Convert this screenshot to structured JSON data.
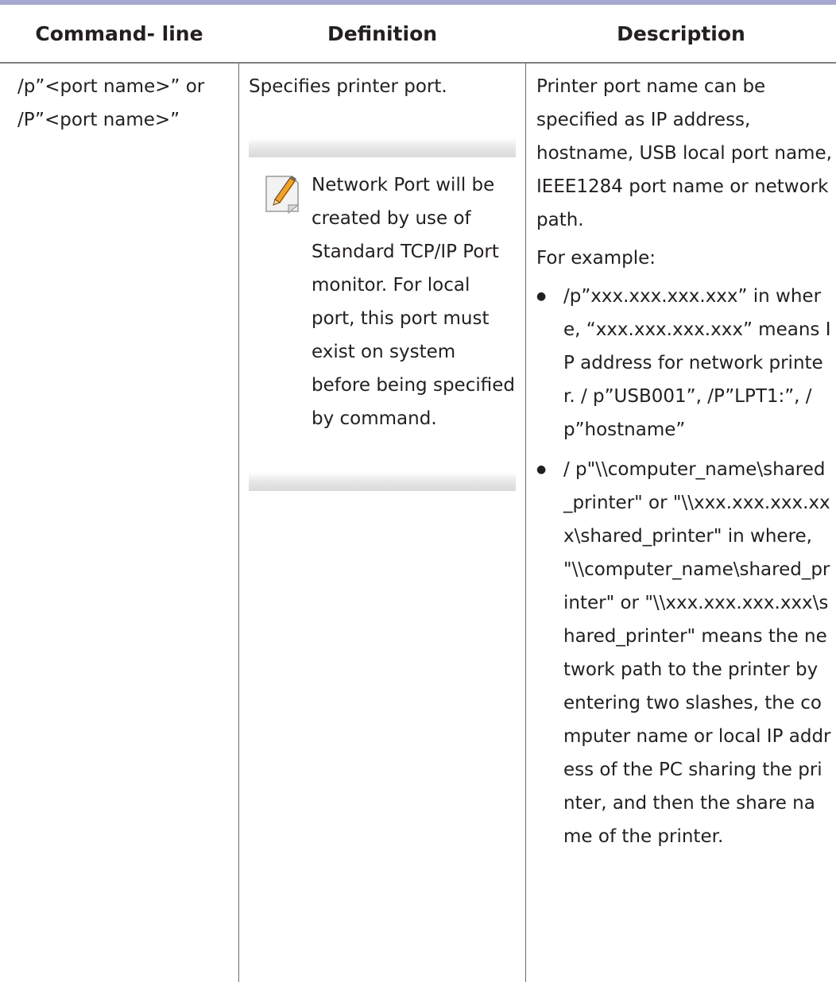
{
  "table": {
    "headers": [
      "Command- line",
      "Definition",
      "Description"
    ],
    "row": {
      "command": {
        "line1": "/p”<port name>” or",
        "line2": "/P”<port name>”"
      },
      "definition": {
        "text": "Specifies printer port.",
        "note": {
          "icon": "note-pencil-icon",
          "text": "Network Port will be created by use of Standard TCP/IP Port monitor. For local port, this port must exist on system before being specified by command."
        }
      },
      "description": {
        "intro": "Printer port name can be specified as IP address, hostname, USB local port name, IEEE1284 port name or network path.",
        "example_label": "For example:",
        "bullets": [
          "/p”xxx.xxx.xxx.xxx” in where, “xxx.xxx.xxx.xxx” means IP address for network printer. / p”USB001”, /P”LPT1:”, / p”hostname”",
          "/ p\"\\\\computer_name\\shared_printer\" or \"\\\\xxx.xxx.xxx.xxx\\shared_printer\" in where, \"\\\\computer_name\\shared_printer\" or \"\\\\xxx.xxx.xxx.xxx\\shared_printer\" means the network path to the printer by entering two slashes, the computer name or local IP address of the PC sharing the printer, and then the share name of the printer."
        ]
      }
    }
  },
  "colors": {
    "top_rule": "#a6a8d1",
    "text": "#231f20",
    "divider": "#6d6d6d",
    "note_icon_accent": "#f0a22b"
  }
}
